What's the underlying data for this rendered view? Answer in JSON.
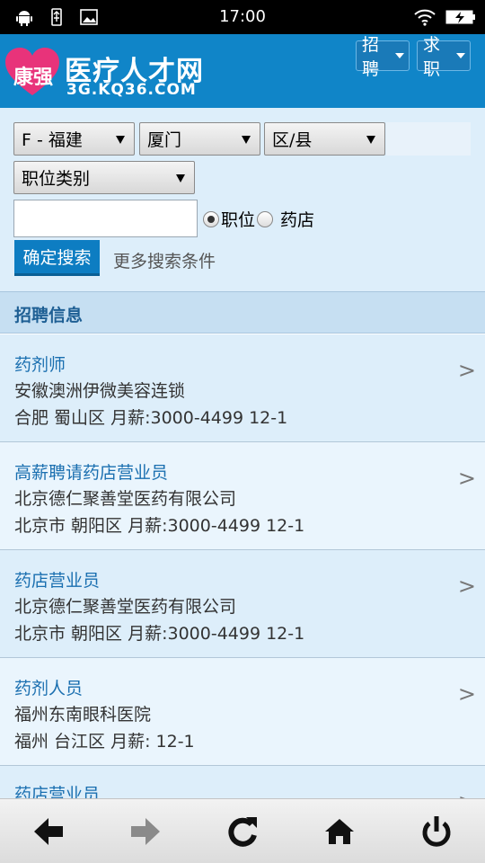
{
  "status_bar": {
    "time": "17:00",
    "left_icons": [
      "android-icon",
      "usb-icon",
      "image-icon"
    ],
    "right_icons": [
      "wifi-icon",
      "battery-charging-icon"
    ]
  },
  "header": {
    "logo_heart_text": "康强",
    "logo_title": "医疗人才网",
    "logo_subtitle": "3G.KQ36.COM",
    "recruit_label": "招聘",
    "seek_label": "求职",
    "brand_color": "#1085c8",
    "heart_color": "#e8337a"
  },
  "search": {
    "province": "F - 福建",
    "city": "厦门",
    "district": "区/县",
    "category": "职位类别",
    "keyword_value": "",
    "radio_position_label": "职位",
    "radio_pharmacy_label": "药店",
    "selected_radio": "职位",
    "submit_label": "确定搜索",
    "more_label": "更多搜索条件"
  },
  "section": {
    "title": "招聘信息"
  },
  "jobs": [
    {
      "title": "药剂师",
      "company": "安徽澳洲伊微美容连锁",
      "meta": "合肥 蜀山区 月薪:3000-4499 12-1"
    },
    {
      "title": "高薪聘请药店营业员",
      "company": "北京德仁聚善堂医药有限公司",
      "meta": "北京市 朝阳区 月薪:3000-4499 12-1"
    },
    {
      "title": "药店营业员",
      "company": "北京德仁聚善堂医药有限公司",
      "meta": "北京市 朝阳区 月薪:3000-4499 12-1"
    },
    {
      "title": "药剂人员",
      "company": "福州东南眼科医院",
      "meta": "福州 台江区 月薪: 12-1"
    },
    {
      "title": "药店营业员",
      "company": "",
      "meta": ""
    }
  ],
  "chevron": ">",
  "bottom_nav": [
    "back-arrow-icon",
    "forward-arrow-icon",
    "refresh-icon",
    "home-icon",
    "power-icon"
  ]
}
